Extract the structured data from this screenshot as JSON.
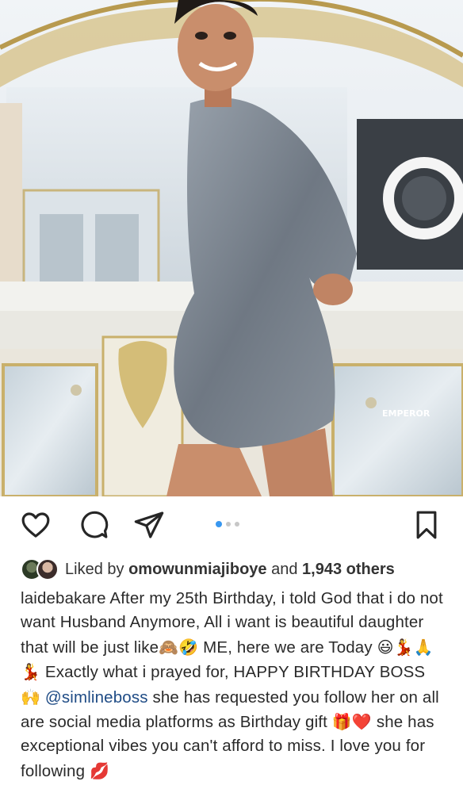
{
  "post": {
    "image_watermark": "EMPEROR",
    "carousel": {
      "count": 3,
      "active_index": 0
    }
  },
  "likes": {
    "liked_by_prefix": "Liked by",
    "liked_by_user": "omowunmiajiboye",
    "and_text": "and",
    "others_count": "1,943 others"
  },
  "caption": {
    "username": "laidebakare",
    "text_1": " After my 25th Birthday, i told God that i do not want Husband Anymore, All i want is beautiful daughter that will be just like",
    "emoji_1": "🙈🤣",
    "text_2": " ME, here we are Today ",
    "emoji_2": "😃💃🙏💃",
    "text_3": " Exactly what i prayed for, HAPPY BIRTHDAY BOSS ",
    "emoji_3": "🙌",
    "mention": " @simlineboss",
    "text_4": "  she has requested you follow her on all are social media platforms as Birthday gift ",
    "emoji_4": "🎁❤️",
    "text_5": " she has exceptional vibes you can't afford to miss. I love you for following ",
    "emoji_5": "💋"
  },
  "icons": {
    "like": "heart-icon",
    "comment": "comment-icon",
    "share": "send-icon",
    "save": "bookmark-icon"
  },
  "colors": {
    "carousel_active": "#3897f0",
    "carousel_inactive": "#c7c7c7",
    "mention": "#1e4b85"
  }
}
